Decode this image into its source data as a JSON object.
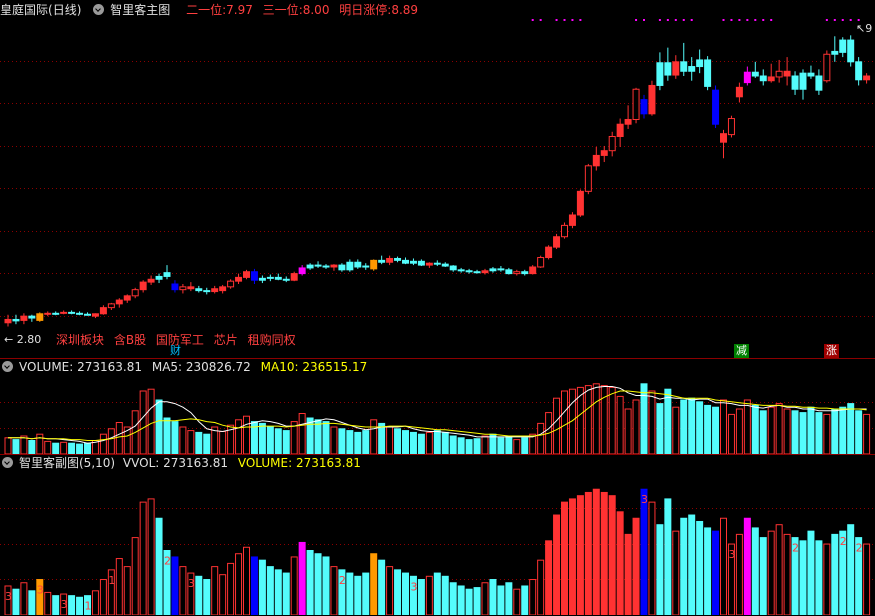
{
  "main_panel": {
    "stock_name": "皇庭国际",
    "period": "(日线)",
    "indicator_name": "智里客主图",
    "metrics": [
      {
        "label": "二一位",
        "value": "7.97"
      },
      {
        "label": "三一位",
        "value": "8.00"
      },
      {
        "label": "明日涨停",
        "value": "8.89"
      }
    ],
    "low_price_label": "2.80",
    "high_price_label": "9",
    "concepts": [
      "深圳板块",
      "含B股",
      "国防军工",
      "芯片",
      "租购同权"
    ],
    "markers": [
      {
        "text": "财",
        "color": "#00bfff"
      },
      {
        "text": "减",
        "color": "#00c000"
      },
      {
        "text": "涨",
        "color": "#ff4040"
      }
    ]
  },
  "volume_panel": {
    "name": "VOLUME",
    "value": "273163.81",
    "ma5_label": "MA5",
    "ma5_value": "230826.72",
    "ma10_label": "MA10",
    "ma10_value": "236515.17"
  },
  "sub_panel": {
    "name": "智里客副图(5,10)",
    "vvol_label": "VVOL",
    "vvol_value": "273163.81",
    "volume_label": "VOLUME",
    "volume_value": "273163.81",
    "bar_digits": [
      "3",
      "3",
      "3",
      "1",
      "1",
      "2",
      "3",
      "2",
      "3",
      "3",
      "3",
      "2",
      "2",
      "2"
    ]
  },
  "colors": {
    "up": "#ff3232",
    "down": "#54fcfc",
    "blue": "#0000ff",
    "magenta": "#ff00ff",
    "orange": "#ff9900",
    "grid": "#8b0000",
    "ma5": "#ffffff",
    "ma10": "#ffff00"
  },
  "chart_data": {
    "type": "candlestick",
    "price_ylim": [
      2.6,
      9.2
    ],
    "candles": [
      {
        "o": 2.88,
        "h": 3.05,
        "l": 2.8,
        "c": 2.95,
        "t": "up"
      },
      {
        "o": 2.95,
        "h": 3.05,
        "l": 2.85,
        "c": 2.92,
        "t": "down"
      },
      {
        "o": 2.93,
        "h": 3.08,
        "l": 2.85,
        "c": 3.02,
        "t": "up"
      },
      {
        "o": 2.98,
        "h": 3.05,
        "l": 2.9,
        "c": 3.02,
        "t": "down"
      },
      {
        "o": 2.93,
        "h": 3.1,
        "l": 2.9,
        "c": 3.07,
        "t": "orange"
      },
      {
        "o": 3.06,
        "h": 3.12,
        "l": 3.02,
        "c": 3.08,
        "t": "up"
      },
      {
        "o": 3.08,
        "h": 3.12,
        "l": 3.04,
        "c": 3.07,
        "t": "down"
      },
      {
        "o": 3.08,
        "h": 3.14,
        "l": 3.06,
        "c": 3.1,
        "t": "up"
      },
      {
        "o": 3.1,
        "h": 3.14,
        "l": 3.06,
        "c": 3.08,
        "t": "down"
      },
      {
        "o": 3.08,
        "h": 3.12,
        "l": 3.04,
        "c": 3.06,
        "t": "down"
      },
      {
        "o": 3.06,
        "h": 3.1,
        "l": 3.03,
        "c": 3.05,
        "t": "down"
      },
      {
        "o": 3.02,
        "h": 3.08,
        "l": 2.98,
        "c": 3.07,
        "t": "up"
      },
      {
        "o": 3.07,
        "h": 3.25,
        "l": 3.05,
        "c": 3.2,
        "t": "up"
      },
      {
        "o": 3.2,
        "h": 3.3,
        "l": 3.15,
        "c": 3.28,
        "t": "up"
      },
      {
        "o": 3.28,
        "h": 3.4,
        "l": 3.2,
        "c": 3.36,
        "t": "up"
      },
      {
        "o": 3.36,
        "h": 3.48,
        "l": 3.3,
        "c": 3.45,
        "t": "up"
      },
      {
        "o": 3.45,
        "h": 3.62,
        "l": 3.4,
        "c": 3.58,
        "t": "up"
      },
      {
        "o": 3.58,
        "h": 3.78,
        "l": 3.52,
        "c": 3.74,
        "t": "up"
      },
      {
        "o": 3.74,
        "h": 3.88,
        "l": 3.68,
        "c": 3.8,
        "t": "up"
      },
      {
        "o": 3.8,
        "h": 3.92,
        "l": 3.72,
        "c": 3.86,
        "t": "down"
      },
      {
        "o": 3.86,
        "h": 4.1,
        "l": 3.8,
        "c": 3.94,
        "t": "down"
      },
      {
        "o": 3.7,
        "h": 3.78,
        "l": 3.52,
        "c": 3.58,
        "t": "blue"
      },
      {
        "o": 3.58,
        "h": 3.7,
        "l": 3.5,
        "c": 3.64,
        "t": "up"
      },
      {
        "o": 3.64,
        "h": 3.74,
        "l": 3.55,
        "c": 3.6,
        "t": "up"
      },
      {
        "o": 3.6,
        "h": 3.66,
        "l": 3.52,
        "c": 3.56,
        "t": "down"
      },
      {
        "o": 3.56,
        "h": 3.62,
        "l": 3.48,
        "c": 3.54,
        "t": "down"
      },
      {
        "o": 3.54,
        "h": 3.66,
        "l": 3.5,
        "c": 3.6,
        "t": "up"
      },
      {
        "o": 3.56,
        "h": 3.68,
        "l": 3.5,
        "c": 3.64,
        "t": "up"
      },
      {
        "o": 3.64,
        "h": 3.8,
        "l": 3.6,
        "c": 3.76,
        "t": "up"
      },
      {
        "o": 3.76,
        "h": 3.92,
        "l": 3.7,
        "c": 3.84,
        "t": "up"
      },
      {
        "o": 3.84,
        "h": 4.0,
        "l": 3.8,
        "c": 3.96,
        "t": "up"
      },
      {
        "o": 3.96,
        "h": 4.02,
        "l": 3.7,
        "c": 3.78,
        "t": "blue"
      },
      {
        "o": 3.78,
        "h": 3.88,
        "l": 3.72,
        "c": 3.82,
        "t": "down"
      },
      {
        "o": 3.82,
        "h": 3.9,
        "l": 3.76,
        "c": 3.84,
        "t": "down"
      },
      {
        "o": 3.84,
        "h": 3.92,
        "l": 3.78,
        "c": 3.8,
        "t": "down"
      },
      {
        "o": 3.8,
        "h": 3.86,
        "l": 3.74,
        "c": 3.78,
        "t": "down"
      },
      {
        "o": 3.78,
        "h": 3.96,
        "l": 3.76,
        "c": 3.92,
        "t": "up"
      },
      {
        "o": 3.92,
        "h": 4.1,
        "l": 3.88,
        "c": 4.04,
        "t": "magenta"
      },
      {
        "o": 4.04,
        "h": 4.14,
        "l": 4.0,
        "c": 4.1,
        "t": "down"
      },
      {
        "o": 4.1,
        "h": 4.18,
        "l": 4.04,
        "c": 4.08,
        "t": "down"
      },
      {
        "o": 4.08,
        "h": 4.12,
        "l": 4.02,
        "c": 4.06,
        "t": "down"
      },
      {
        "o": 4.06,
        "h": 4.12,
        "l": 3.98,
        "c": 4.1,
        "t": "up"
      },
      {
        "o": 4.1,
        "h": 4.14,
        "l": 3.96,
        "c": 4.0,
        "t": "down"
      },
      {
        "o": 4.0,
        "h": 4.22,
        "l": 3.96,
        "c": 4.16,
        "t": "down"
      },
      {
        "o": 4.16,
        "h": 4.22,
        "l": 4.02,
        "c": 4.06,
        "t": "down"
      },
      {
        "o": 4.06,
        "h": 4.14,
        "l": 4.0,
        "c": 4.08,
        "t": "down"
      },
      {
        "o": 4.02,
        "h": 4.22,
        "l": 3.98,
        "c": 4.2,
        "t": "orange"
      },
      {
        "o": 4.2,
        "h": 4.3,
        "l": 4.12,
        "c": 4.16,
        "t": "down"
      },
      {
        "o": 4.16,
        "h": 4.3,
        "l": 4.1,
        "c": 4.24,
        "t": "up"
      },
      {
        "o": 4.24,
        "h": 4.28,
        "l": 4.16,
        "c": 4.2,
        "t": "down"
      },
      {
        "o": 4.2,
        "h": 4.26,
        "l": 4.12,
        "c": 4.14,
        "t": "down"
      },
      {
        "o": 4.14,
        "h": 4.24,
        "l": 4.1,
        "c": 4.18,
        "t": "down"
      },
      {
        "o": 4.18,
        "h": 4.22,
        "l": 4.08,
        "c": 4.1,
        "t": "down"
      },
      {
        "o": 4.1,
        "h": 4.16,
        "l": 4.04,
        "c": 4.14,
        "t": "up"
      },
      {
        "o": 4.14,
        "h": 4.2,
        "l": 4.08,
        "c": 4.12,
        "t": "down"
      },
      {
        "o": 4.12,
        "h": 4.16,
        "l": 4.06,
        "c": 4.08,
        "t": "down"
      },
      {
        "o": 4.08,
        "h": 4.1,
        "l": 3.96,
        "c": 4.0,
        "t": "down"
      },
      {
        "o": 4.0,
        "h": 4.04,
        "l": 3.94,
        "c": 3.98,
        "t": "down"
      },
      {
        "o": 3.98,
        "h": 4.02,
        "l": 3.92,
        "c": 3.96,
        "t": "down"
      },
      {
        "o": 3.96,
        "h": 4.0,
        "l": 3.92,
        "c": 3.94,
        "t": "down"
      },
      {
        "o": 3.94,
        "h": 4.02,
        "l": 3.9,
        "c": 3.98,
        "t": "up"
      },
      {
        "o": 3.98,
        "h": 4.06,
        "l": 3.94,
        "c": 4.02,
        "t": "down"
      },
      {
        "o": 4.02,
        "h": 4.08,
        "l": 3.96,
        "c": 4.0,
        "t": "down"
      },
      {
        "o": 4.0,
        "h": 4.04,
        "l": 3.9,
        "c": 3.92,
        "t": "down"
      },
      {
        "o": 3.92,
        "h": 4.0,
        "l": 3.88,
        "c": 3.96,
        "t": "up"
      },
      {
        "o": 3.96,
        "h": 4.0,
        "l": 3.88,
        "c": 3.92,
        "t": "down"
      },
      {
        "o": 3.92,
        "h": 4.1,
        "l": 3.9,
        "c": 4.06,
        "t": "up"
      },
      {
        "o": 4.06,
        "h": 4.3,
        "l": 4.04,
        "c": 4.26,
        "t": "up"
      },
      {
        "o": 4.26,
        "h": 4.52,
        "l": 4.22,
        "c": 4.48,
        "t": "up"
      },
      {
        "o": 4.48,
        "h": 4.76,
        "l": 4.44,
        "c": 4.7,
        "t": "up"
      },
      {
        "o": 4.7,
        "h": 5.0,
        "l": 4.66,
        "c": 4.94,
        "t": "up"
      },
      {
        "o": 4.94,
        "h": 5.22,
        "l": 4.88,
        "c": 5.16,
        "t": "up"
      },
      {
        "o": 5.16,
        "h": 5.7,
        "l": 5.12,
        "c": 5.66,
        "t": "up"
      },
      {
        "o": 5.66,
        "h": 6.24,
        "l": 5.6,
        "c": 6.2,
        "t": "up"
      },
      {
        "o": 6.2,
        "h": 6.6,
        "l": 6.1,
        "c": 6.42,
        "t": "up"
      },
      {
        "o": 6.42,
        "h": 6.62,
        "l": 6.28,
        "c": 6.52,
        "t": "up"
      },
      {
        "o": 6.52,
        "h": 6.92,
        "l": 6.4,
        "c": 6.82,
        "t": "up"
      },
      {
        "o": 6.82,
        "h": 7.2,
        "l": 6.6,
        "c": 7.08,
        "t": "up"
      },
      {
        "o": 7.08,
        "h": 7.48,
        "l": 6.98,
        "c": 7.18,
        "t": "up"
      },
      {
        "o": 7.18,
        "h": 7.85,
        "l": 7.1,
        "c": 7.82,
        "t": "up"
      },
      {
        "o": 7.6,
        "h": 7.7,
        "l": 7.2,
        "c": 7.3,
        "t": "blue"
      },
      {
        "o": 7.3,
        "h": 8.0,
        "l": 7.26,
        "c": 7.9,
        "t": "up"
      },
      {
        "o": 7.9,
        "h": 8.6,
        "l": 7.8,
        "c": 8.38,
        "t": "down"
      },
      {
        "o": 8.38,
        "h": 8.7,
        "l": 8.0,
        "c": 8.12,
        "t": "down"
      },
      {
        "o": 8.12,
        "h": 8.54,
        "l": 8.04,
        "c": 8.4,
        "t": "up"
      },
      {
        "o": 8.4,
        "h": 8.8,
        "l": 8.1,
        "c": 8.2,
        "t": "down"
      },
      {
        "o": 8.2,
        "h": 8.5,
        "l": 8.0,
        "c": 8.3,
        "t": "down"
      },
      {
        "o": 8.3,
        "h": 8.66,
        "l": 8.16,
        "c": 8.44,
        "t": "down"
      },
      {
        "o": 8.44,
        "h": 8.52,
        "l": 7.8,
        "c": 7.88,
        "t": "down"
      },
      {
        "o": 7.8,
        "h": 7.9,
        "l": 7.0,
        "c": 7.08,
        "t": "blue"
      },
      {
        "o": 6.7,
        "h": 6.96,
        "l": 6.36,
        "c": 6.88,
        "t": "up"
      },
      {
        "o": 6.86,
        "h": 7.26,
        "l": 6.8,
        "c": 7.2,
        "t": "up"
      },
      {
        "o": 7.66,
        "h": 7.96,
        "l": 7.54,
        "c": 7.86,
        "t": "up"
      },
      {
        "o": 7.96,
        "h": 8.3,
        "l": 7.9,
        "c": 8.18,
        "t": "magenta"
      },
      {
        "o": 8.18,
        "h": 8.4,
        "l": 8.06,
        "c": 8.1,
        "t": "down"
      },
      {
        "o": 8.1,
        "h": 8.24,
        "l": 7.9,
        "c": 8.0,
        "t": "down"
      },
      {
        "o": 8.0,
        "h": 8.36,
        "l": 7.96,
        "c": 8.08,
        "t": "up"
      },
      {
        "o": 8.08,
        "h": 8.44,
        "l": 7.96,
        "c": 8.2,
        "t": "up"
      },
      {
        "o": 8.2,
        "h": 8.5,
        "l": 7.9,
        "c": 8.1,
        "t": "up"
      },
      {
        "o": 8.1,
        "h": 8.2,
        "l": 7.7,
        "c": 7.82,
        "t": "down"
      },
      {
        "o": 7.82,
        "h": 8.24,
        "l": 7.6,
        "c": 8.16,
        "t": "down"
      },
      {
        "o": 8.16,
        "h": 8.32,
        "l": 8.04,
        "c": 8.1,
        "t": "down"
      },
      {
        "o": 8.1,
        "h": 8.24,
        "l": 7.7,
        "c": 7.8,
        "t": "down"
      },
      {
        "o": 8.0,
        "h": 8.64,
        "l": 7.96,
        "c": 8.56,
        "t": "up"
      },
      {
        "o": 8.56,
        "h": 8.94,
        "l": 8.4,
        "c": 8.62,
        "t": "down"
      },
      {
        "o": 8.6,
        "h": 8.92,
        "l": 8.5,
        "c": 8.86,
        "t": "down"
      },
      {
        "o": 8.86,
        "h": 8.96,
        "l": 8.3,
        "c": 8.4,
        "t": "down"
      },
      {
        "o": 8.4,
        "h": 8.5,
        "l": 7.9,
        "c": 8.02,
        "t": "down"
      },
      {
        "o": 8.02,
        "h": 8.16,
        "l": 7.94,
        "c": 8.1,
        "t": "up"
      }
    ],
    "volume_series": [
      {
        "name": "VOLUME",
        "values": [
          18,
          16,
          20,
          15,
          22,
          14,
          12,
          13,
          12,
          11,
          12,
          15,
          22,
          28,
          35,
          30,
          48,
          70,
          72,
          60,
          40,
          36,
          30,
          26,
          24,
          22,
          30,
          25,
          32,
          38,
          42,
          36,
          34,
          30,
          28,
          26,
          36,
          45,
          40,
          38,
          36,
          30,
          28,
          26,
          24,
          26,
          38,
          34,
          30,
          28,
          26,
          24,
          22,
          24,
          26,
          24,
          20,
          18,
          16,
          17,
          20,
          22,
          18,
          20,
          16,
          18,
          22,
          34,
          46,
          62,
          70,
          72,
          74,
          76,
          78,
          76,
          74,
          64,
          50,
          60,
          78,
          70,
          56,
          72,
          52,
          60,
          62,
          58,
          54,
          52,
          60,
          44,
          50,
          60,
          54,
          48,
          52,
          56,
          50,
          48,
          46,
          52,
          46,
          44,
          50,
          52,
          56,
          48,
          44
        ]
      },
      {
        "name": "MA5",
        "values": [
          18,
          18,
          18,
          17,
          18,
          17,
          17,
          16,
          15,
          14,
          12,
          13,
          15,
          18,
          22,
          26,
          31,
          41,
          51,
          58,
          58,
          56,
          52,
          46,
          36,
          28,
          26,
          25,
          27,
          29,
          33,
          35,
          37,
          36,
          34,
          31,
          31,
          33,
          35,
          37,
          39,
          38,
          35,
          32,
          29,
          27,
          28,
          30,
          30,
          30,
          31,
          28,
          26,
          25,
          25,
          24,
          23,
          22,
          21,
          19,
          19,
          19,
          19,
          19,
          19,
          19,
          19,
          22,
          28,
          37,
          47,
          57,
          65,
          71,
          74,
          75,
          75,
          73,
          68,
          65,
          65,
          64,
          61,
          63,
          62,
          62,
          60,
          61,
          61,
          57,
          57,
          56,
          54,
          54,
          52,
          51,
          53,
          54,
          52,
          52,
          50,
          50,
          48,
          48,
          48,
          49,
          50,
          50,
          50
        ]
      },
      {
        "name": "MA10",
        "values": [
          18,
          18,
          18,
          17,
          18,
          17,
          17,
          17,
          16,
          16,
          15,
          15,
          16,
          17,
          19,
          20,
          24,
          29,
          34,
          37,
          37,
          37,
          38,
          39,
          38,
          36,
          35,
          32,
          30,
          29,
          30,
          30,
          31,
          31,
          31,
          30,
          31,
          32,
          33,
          33,
          34,
          34,
          33,
          32,
          31,
          30,
          30,
          30,
          31,
          31,
          31,
          30,
          29,
          28,
          27,
          27,
          26,
          25,
          24,
          23,
          22,
          22,
          21,
          20,
          20,
          20,
          20,
          21,
          23,
          27,
          32,
          37,
          44,
          51,
          58,
          63,
          67,
          70,
          70,
          69,
          68,
          68,
          67,
          66,
          64,
          62,
          62,
          62,
          62,
          60,
          59,
          58,
          57,
          56,
          55,
          54,
          54,
          54,
          53,
          53,
          52,
          52,
          51,
          51,
          50,
          50,
          50,
          50,
          49
        ]
      }
    ]
  }
}
